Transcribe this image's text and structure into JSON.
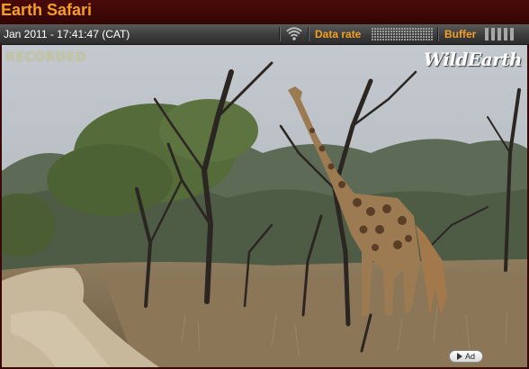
{
  "header": {
    "title": "Earth Safari"
  },
  "status_bar": {
    "timestamp": "Jan 2011 - 17:41:47 (CAT)",
    "signal_icon": "wifi-signal-icon",
    "data_rate_label": "Data rate",
    "buffer_label": "Buffer"
  },
  "video": {
    "recorded_overlay": "RECORDED",
    "watermark": "WildEarth",
    "ad_button_label": "Ad",
    "ad_icon": "play-triangle-icon"
  },
  "colors": {
    "accent": "#f3a023",
    "title_bar": "#3a0806",
    "info_bar": "#3c3c3c"
  }
}
